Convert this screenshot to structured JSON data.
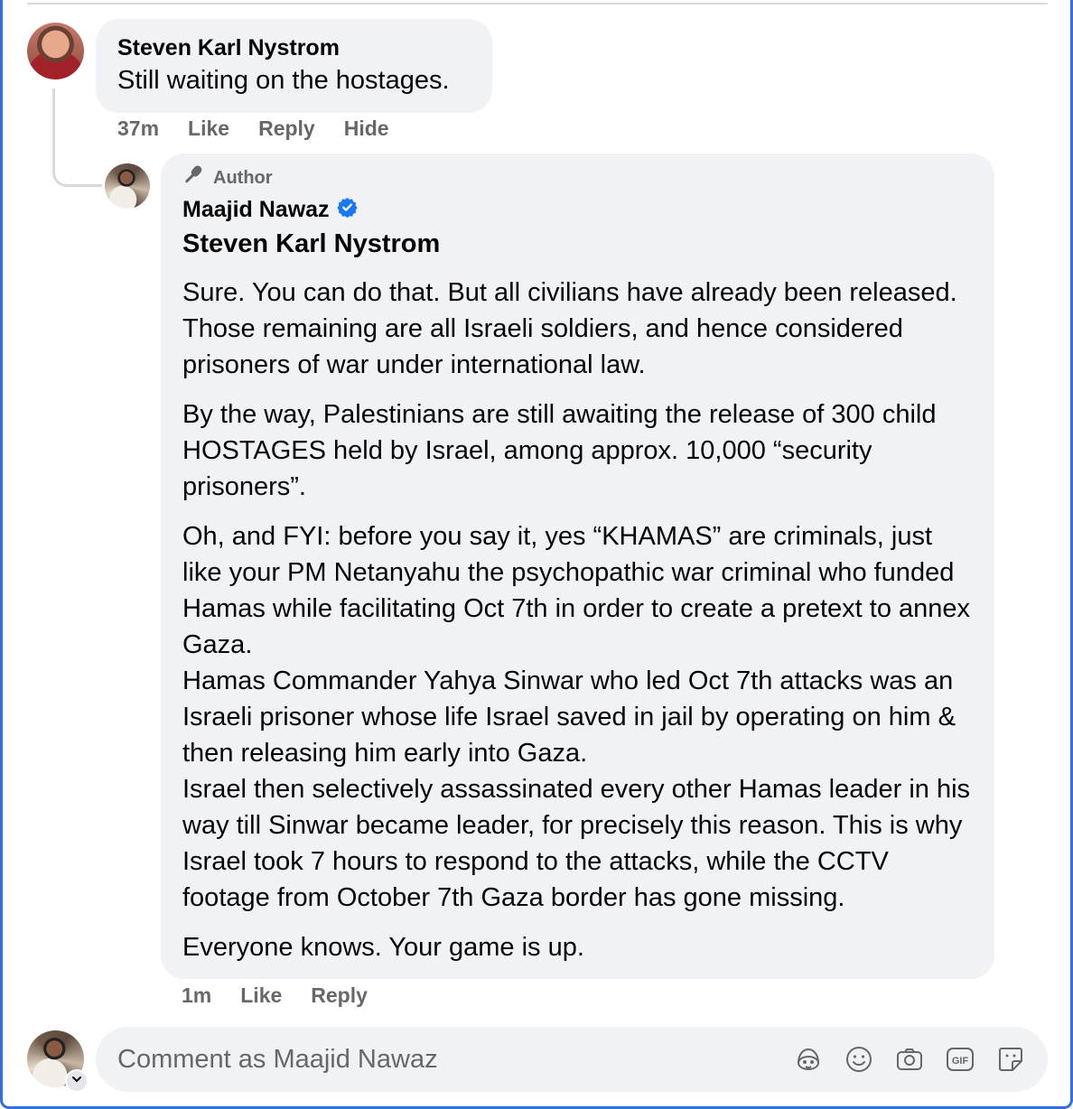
{
  "comment": {
    "author": "Steven Karl Nystrom",
    "text": "Still waiting on the hostages.",
    "time": "37m",
    "actions": [
      "Like",
      "Reply",
      "Hide"
    ]
  },
  "reply": {
    "badge": "Author",
    "author": "Maajid Nawaz",
    "verified": true,
    "mention": "Steven Karl Nystrom",
    "paragraphs": [
      "Sure. You can do that. But all civilians have already been released. Those remaining are all Israeli soldiers, and hence considered prisoners of war under international law.",
      "By the way, Palestinians are still awaiting the release of 300 child HOSTAGES held by Israel, among approx. 10,000 “security prisoners”.",
      "Oh, and FYI: before you say it, yes “KHAMAS” are criminals, just like your PM Netanyahu the psychopathic war criminal who funded Hamas while facilitating Oct 7th in order to create a pretext to annex Gaza.",
      "Hamas Commander Yahya Sinwar who led Oct 7th attacks was an Israeli prisoner whose life Israel saved in jail by operating on him & then releasing him early into Gaza.",
      "Israel then selectively assassinated every other Hamas leader in his way till Sinwar became leader, for precisely this reason. This is why Israel took 7 hours to respond to the attacks, while the CCTV footage from October 7th Gaza border has gone missing.",
      "Everyone knows. Your game is up."
    ],
    "time": "1m",
    "actions": [
      "Like",
      "Reply"
    ]
  },
  "composer": {
    "placeholder": "Comment as Maajid Nawaz",
    "tools": [
      "avatar-sticker-icon",
      "emoji-icon",
      "camera-icon",
      "gif-icon",
      "sticker-icon"
    ]
  },
  "colors": {
    "frame": "#2f6fe0",
    "bubble": "#f0f2f5",
    "muted": "#65676b",
    "verified": "#1877f2"
  }
}
